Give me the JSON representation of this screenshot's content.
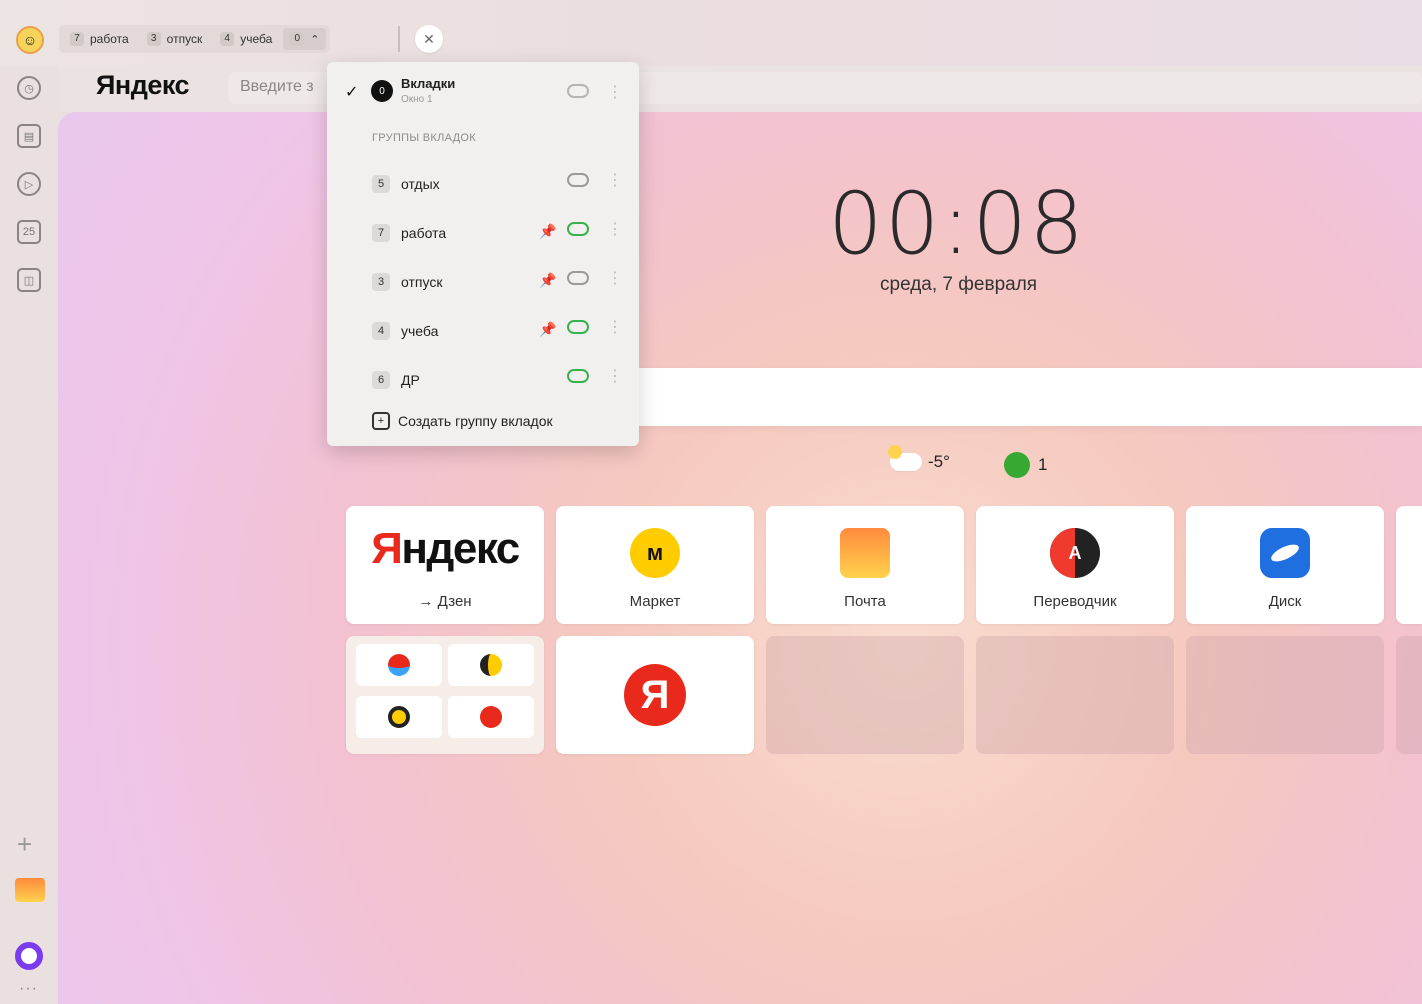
{
  "tabbar": {
    "groups": [
      {
        "count": "7",
        "label": "работа"
      },
      {
        "count": "3",
        "label": "отпуск"
      },
      {
        "count": "4",
        "label": "учеба"
      }
    ],
    "more_count": "0",
    "close_icon": "close-icon"
  },
  "address": {
    "brand": "Яндекс",
    "placeholder": "Введите з"
  },
  "menu": {
    "window_title": "Вкладки",
    "window_sub": "Окно 1",
    "section_label": "ГРУППЫ ВКЛАДОК",
    "rows": [
      {
        "count": "5",
        "name": "отдых",
        "pinned": false,
        "synced": false
      },
      {
        "count": "7",
        "name": "работа",
        "pinned": true,
        "synced": true
      },
      {
        "count": "3",
        "name": "отпуск",
        "pinned": true,
        "synced": false
      },
      {
        "count": "4",
        "name": "учеба",
        "pinned": true,
        "synced": true
      },
      {
        "count": "6",
        "name": "ДР",
        "pinned": false,
        "synced": true
      }
    ],
    "create_label": "Создать группу вкладок"
  },
  "main": {
    "time": "00:08",
    "date": "среда, 7 февраля",
    "weather": "-5°",
    "traffic": "1"
  },
  "tiles": [
    {
      "label": "→ Дзен",
      "logo": "Яндекс"
    },
    {
      "label": "Маркет"
    },
    {
      "label": "Почта"
    },
    {
      "label": "Переводчик"
    },
    {
      "label": "Диск"
    }
  ],
  "big_tile_letter": "Я",
  "colors": {
    "accent_red": "#e8291c",
    "sync_green": "#37b24d",
    "alice_purple": "#7b3cf0"
  }
}
